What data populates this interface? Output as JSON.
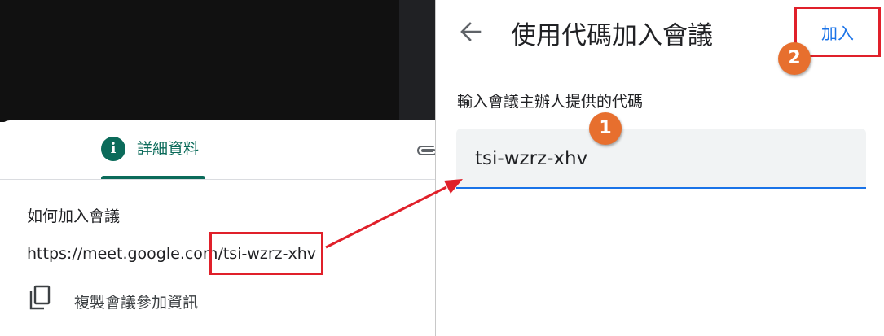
{
  "left_panel": {
    "tab_details_label": "詳細資料",
    "info_icon_glyph": "i",
    "how_to_join_title": "如何加入會議",
    "meeting_link_prefix": "https://meet.google.com/",
    "meeting_code": "tsi-wzrz-xhv",
    "copy_info_label": "複製會議參加資訊",
    "accent_color": "#0b6b5a"
  },
  "right_panel": {
    "title": "使用代碼加入會議",
    "join_button_label": "加入",
    "input_prompt": "輸入會議主辦人提供的代碼",
    "code_value": "tsi-wzrz-xhv",
    "accent_color": "#1a73e8"
  },
  "annotations": {
    "step1": "1",
    "step2": "2",
    "highlight_color": "#e0202a",
    "badge_color": "#e76f2e"
  }
}
